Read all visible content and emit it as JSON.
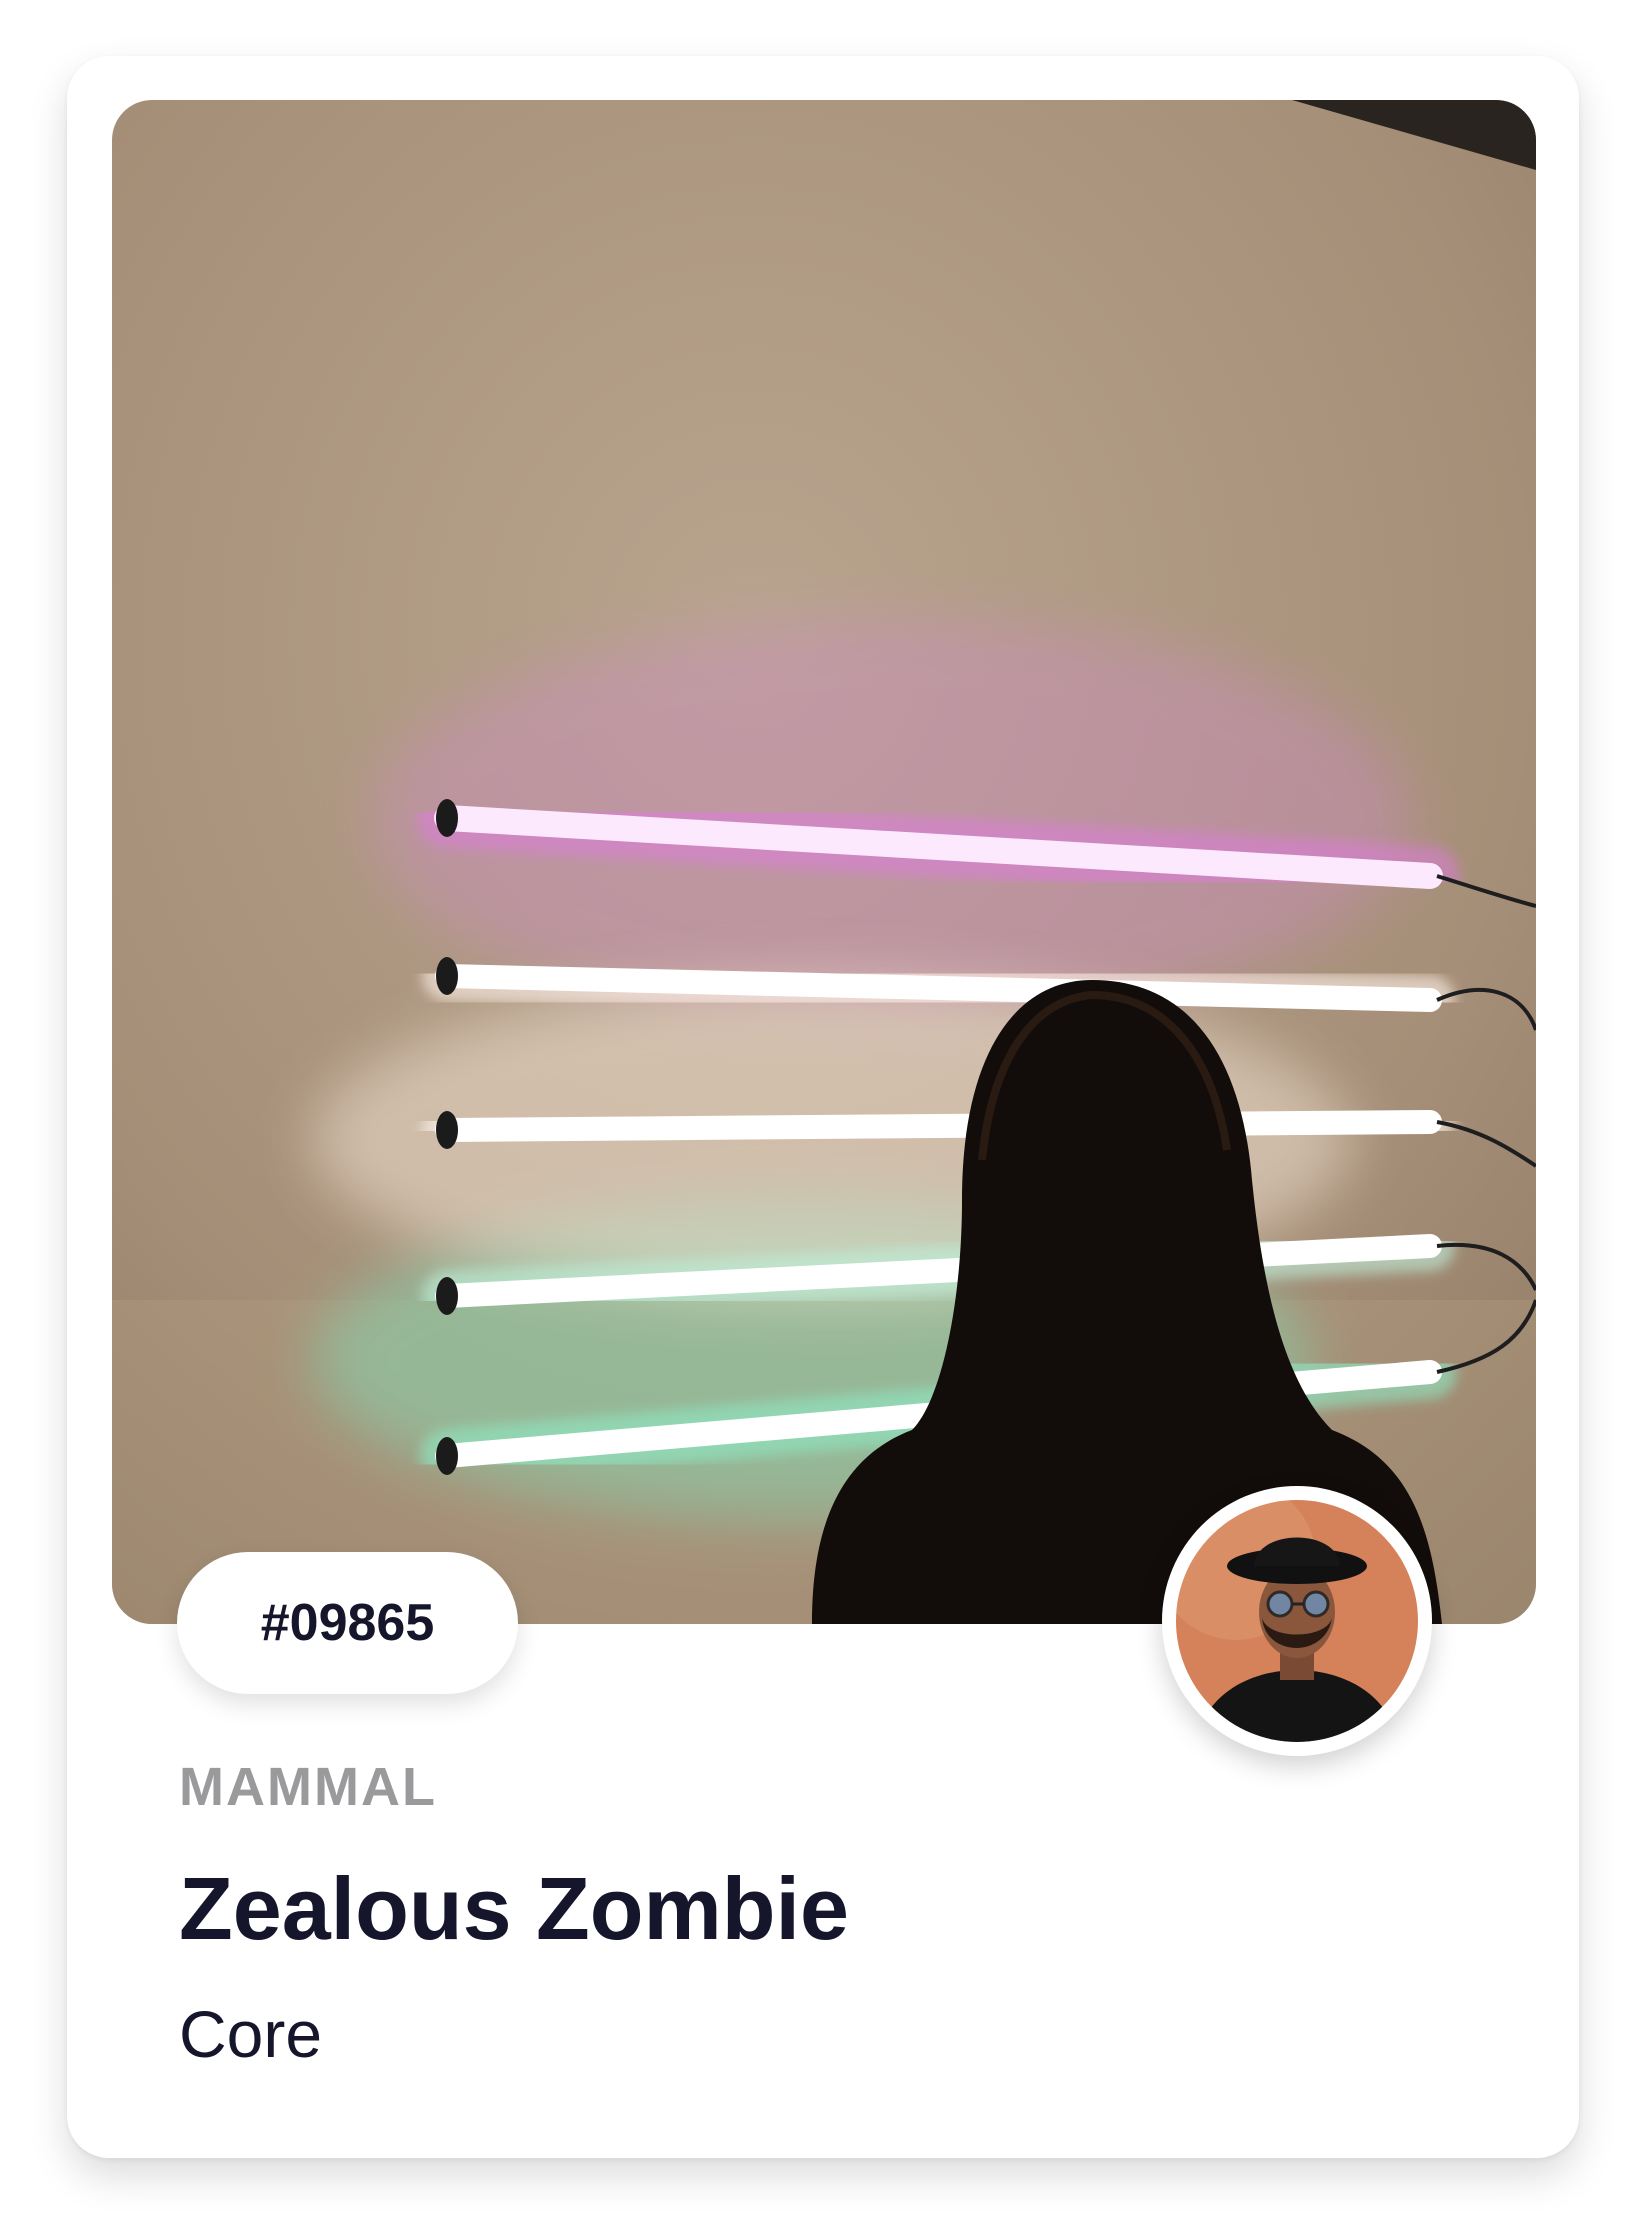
{
  "card": {
    "id": "#09865",
    "category": "MAMMAL",
    "title": "Zealous Zombie",
    "subtitle": "Core"
  },
  "colors": {
    "title": "#15162b",
    "category": "#9a9a9d",
    "background": "#ffffff"
  },
  "icons": [
    "neon-photo",
    "creator-avatar"
  ]
}
